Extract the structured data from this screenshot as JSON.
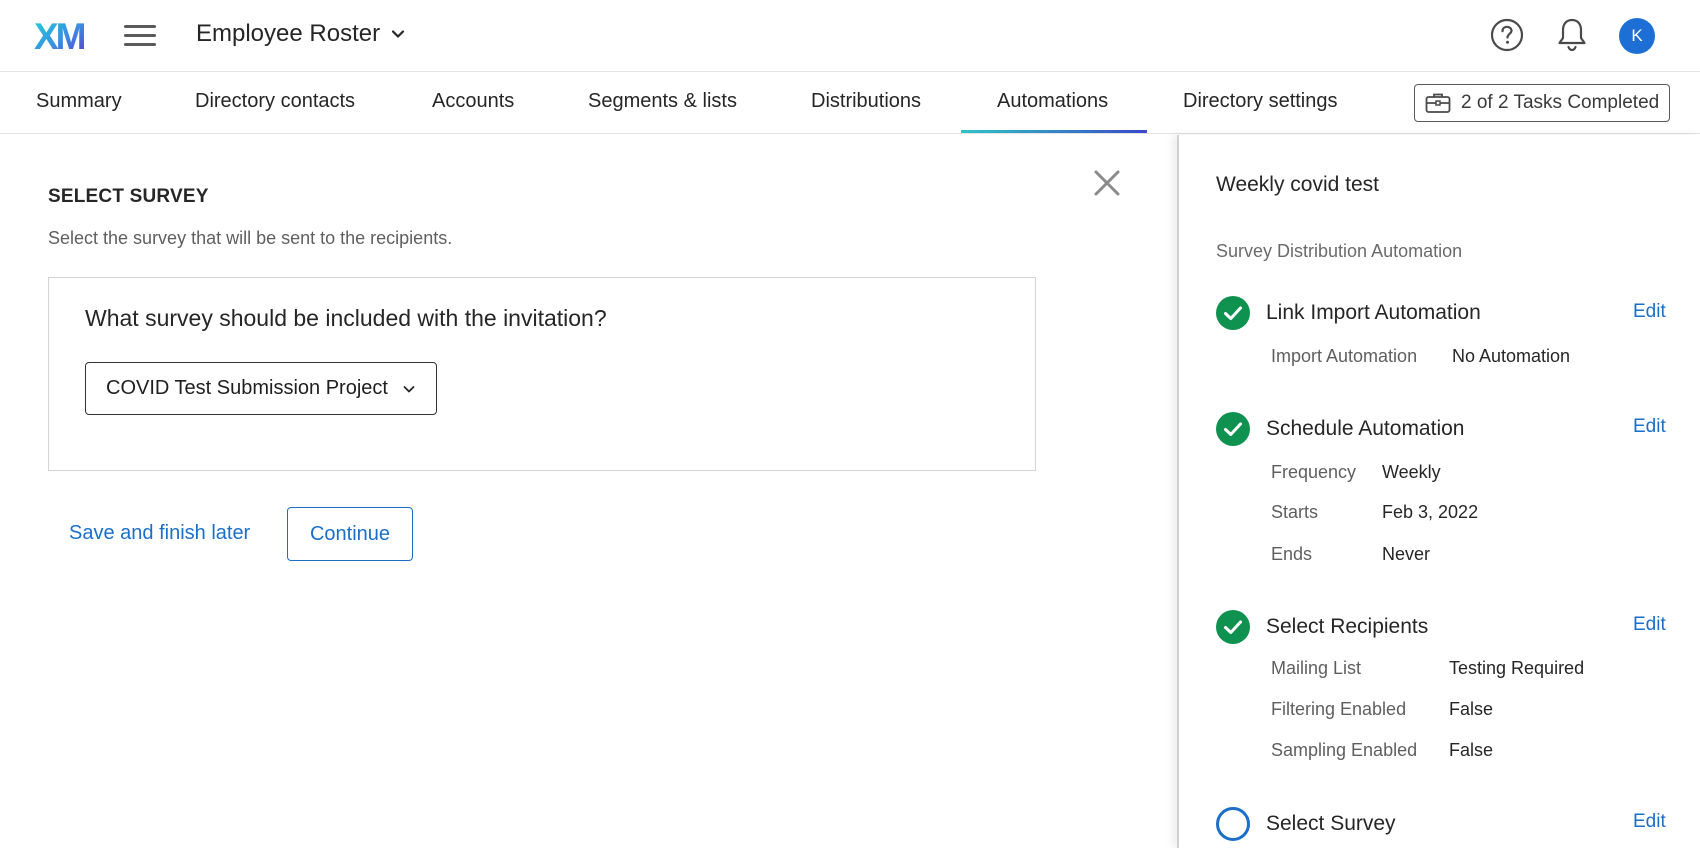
{
  "header": {
    "logo_text": "XM",
    "project_title": "Employee Roster",
    "avatar_initial": "K",
    "icons": [
      "menu-icon",
      "chevron-down-icon",
      "help-icon",
      "bell-icon"
    ],
    "colors": {
      "avatar": "#1d6fd6",
      "accent": "#1b6fc9"
    }
  },
  "tabs": [
    {
      "label": "Summary"
    },
    {
      "label": "Directory contacts"
    },
    {
      "label": "Accounts"
    },
    {
      "label": "Segments & lists"
    },
    {
      "label": "Distributions"
    },
    {
      "label": "Automations",
      "active": true
    },
    {
      "label": "Directory settings"
    }
  ],
  "tasks_badge": "2 of 2 Tasks Completed",
  "main": {
    "section_title": "SELECT SURVEY",
    "section_description": "Select the survey that will be sent to the recipients.",
    "question": "What survey should be included with the invitation?",
    "selected_survey": "COVID Test Submission Project",
    "save_link": "Save and finish later",
    "continue_button": "Continue"
  },
  "side_panel": {
    "automation_name": "Weekly covid test",
    "automation_type": "Survey Distribution Automation",
    "edit_label": "Edit",
    "steps": [
      {
        "title": "Link Import Automation",
        "status": "complete",
        "details": [
          {
            "label": "Import Automation",
            "value": "No Automation"
          }
        ]
      },
      {
        "title": "Schedule Automation",
        "status": "complete",
        "details": [
          {
            "label": "Frequency",
            "value": "Weekly"
          },
          {
            "label": "Starts",
            "value": "Feb 3, 2022"
          },
          {
            "label": "Ends",
            "value": "Never"
          }
        ]
      },
      {
        "title": "Select Recipients",
        "status": "complete",
        "details": [
          {
            "label": "Mailing List",
            "value": "Testing Required"
          },
          {
            "label": "Filtering Enabled",
            "value": "False"
          },
          {
            "label": "Sampling Enabled",
            "value": "False"
          }
        ]
      },
      {
        "title": "Select Survey",
        "status": "in-progress",
        "details": []
      }
    ],
    "colors": {
      "complete": "#0f9150",
      "in_progress": "#1b6fc9"
    }
  }
}
